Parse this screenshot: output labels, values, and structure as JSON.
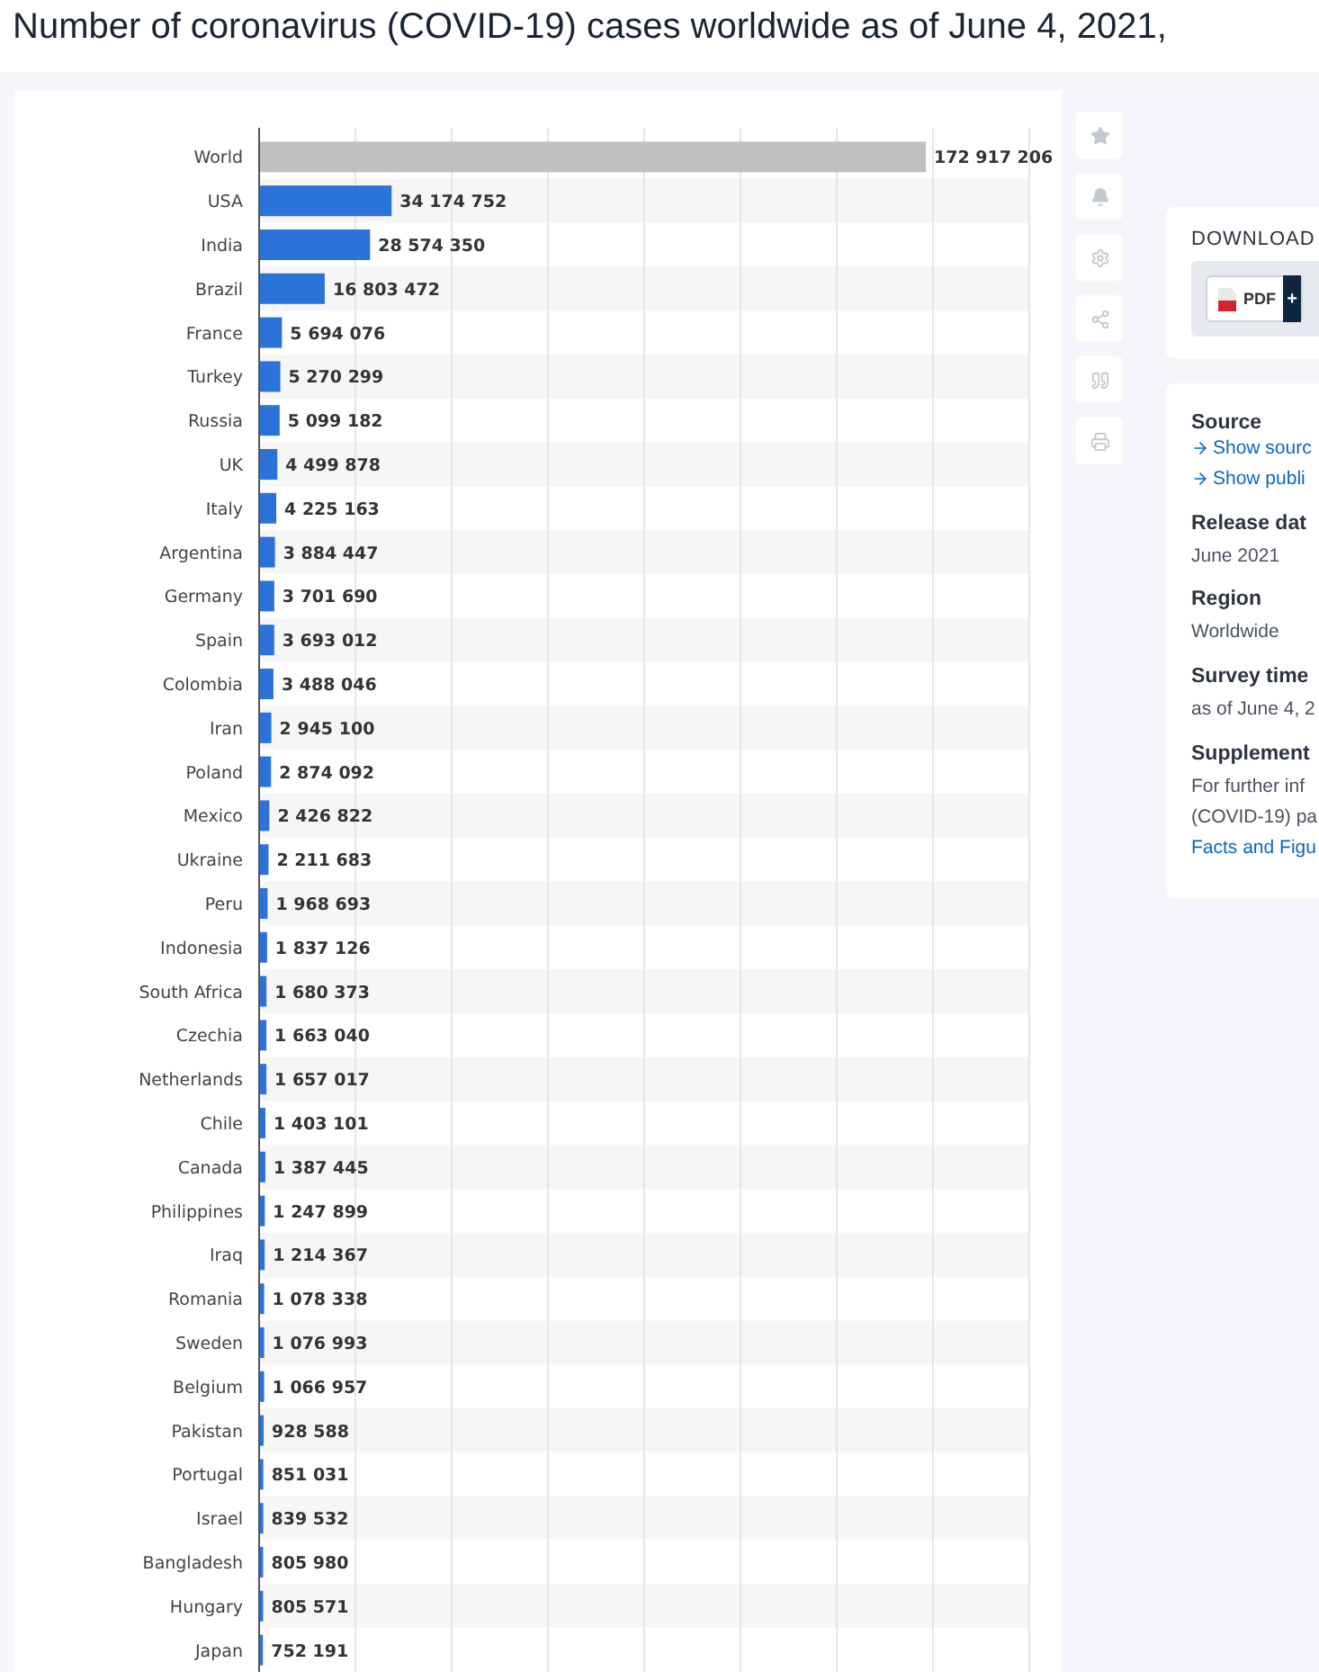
{
  "title": "Number of coronavirus (COVID-19) cases worldwide as of June 4, 2021,",
  "chart": {
    "chart_data": {
      "type": "bar",
      "orientation": "horizontal",
      "data_labels": true,
      "xlim": [
        0,
        200000000
      ],
      "categories": [
        "World",
        "USA",
        "India",
        "Brazil",
        "France",
        "Turkey",
        "Russia",
        "UK",
        "Italy",
        "Argentina",
        "Germany",
        "Spain",
        "Colombia",
        "Iran",
        "Poland",
        "Mexico",
        "Ukraine",
        "Peru",
        "Indonesia",
        "South Africa",
        "Czechia",
        "Netherlands",
        "Chile",
        "Canada",
        "Philippines",
        "Iraq",
        "Romania",
        "Sweden",
        "Belgium",
        "Pakistan",
        "Portugal",
        "Israel",
        "Bangladesh",
        "Hungary",
        "Japan"
      ],
      "value_labels": [
        "172 917 206",
        "34 174 752",
        "28 574 350",
        "16 803 472",
        "5 694 076",
        "5 270 299",
        "5 099 182",
        "4 499 878",
        "4 225 163",
        "3 884 447",
        "3 701 690",
        "3 693 012",
        "3 488 046",
        "2 945 100",
        "2 874 092",
        "2 426 822",
        "2 211 683",
        "1 968 693",
        "1 837 126",
        "1 680 373",
        "1 663 040",
        "1 657 017",
        "1 403 101",
        "1 387 445",
        "1 247 899",
        "1 214 367",
        "1 078 338",
        "1 076 993",
        "1 066 957",
        "928 588",
        "851 031",
        "839 532",
        "805 980",
        "805 571",
        "752 191"
      ],
      "series": [
        {
          "color": "#c0c0c0",
          "values": [
            172917206,
            null,
            null,
            null,
            null,
            null,
            null,
            null,
            null,
            null,
            null,
            null,
            null,
            null,
            null,
            null,
            null,
            null,
            null,
            null,
            null,
            null,
            null,
            null,
            null,
            null,
            null,
            null,
            null,
            null,
            null,
            null,
            null,
            null,
            null
          ]
        },
        {
          "color": "#2b72d9",
          "values": [
            null,
            34174752,
            28574350,
            16803472,
            5694076,
            5270299,
            5099182,
            4499878,
            4225163,
            3884447,
            3701690,
            3693012,
            3488046,
            2945100,
            2874092,
            2426822,
            2211683,
            1968693,
            1837126,
            1680373,
            1663040,
            1657017,
            1403101,
            1387445,
            1247899,
            1214367,
            1078338,
            1076993,
            1066957,
            928588,
            851031,
            839532,
            805980,
            805571,
            752191
          ]
        }
      ]
    }
  },
  "download": {
    "heading": "DOWNLOAD",
    "buttons": [
      {
        "label": "PDF",
        "extra": "+"
      }
    ]
  },
  "info": [
    {
      "heading": "Source",
      "links": [
        "Show sourc",
        "Show publi"
      ]
    },
    {
      "heading": "Release dat",
      "text": "June 2021"
    },
    {
      "heading": "Region",
      "text": "Worldwide"
    },
    {
      "heading": "Survey time",
      "text": "as of June 4, 2"
    },
    {
      "heading": "Supplement",
      "lines": [
        "For further inf",
        "(COVID-19) pa"
      ],
      "links": [
        "Facts and Figu"
      ]
    }
  ]
}
